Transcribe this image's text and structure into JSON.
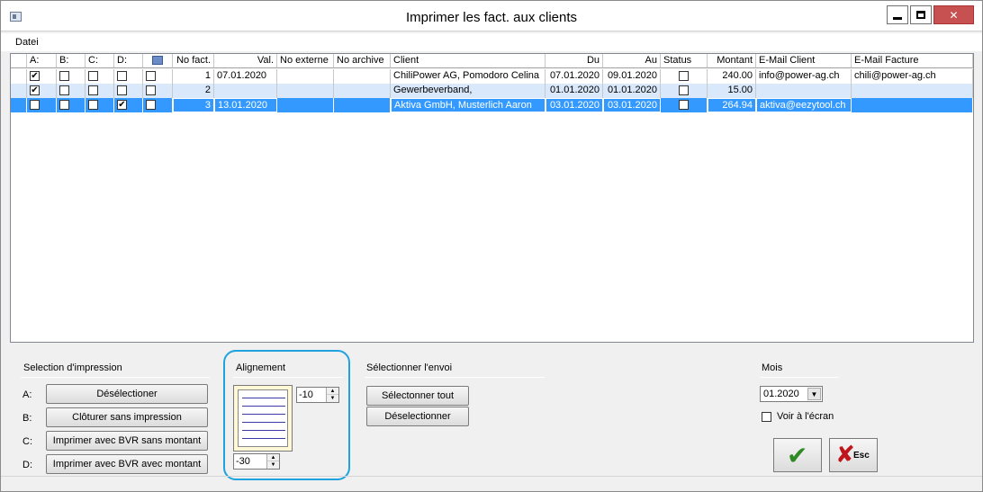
{
  "window": {
    "title": "Imprimer les fact. aux clients"
  },
  "menu": {
    "file": "Datei"
  },
  "table": {
    "headers": {
      "a": "A:",
      "b": "B:",
      "c": "C:",
      "d": "D:",
      "no_fact": "No fact.",
      "val": "Val.",
      "no_externe": "No externe",
      "no_archive": "No archive",
      "client": "Client",
      "du": "Du",
      "au": "Au",
      "status": "Status",
      "montant": "Montant",
      "email_client": "E-Mail Client",
      "email_facture": "E-Mail Facture"
    },
    "rows": [
      {
        "a": "✔",
        "b": "",
        "c": "",
        "d": "",
        "e": "",
        "no_fact": "1",
        "val": "07.01.2020",
        "no_externe": "",
        "no_archive": "",
        "client": "ChiliPower AG, Pomodoro Celina",
        "du": "07.01.2020",
        "au": "09.01.2020",
        "status": "",
        "montant": "240.00",
        "email_client": "info@power-ag.ch",
        "email_facture": "chili@power-ag.ch"
      },
      {
        "a": "✔",
        "b": "",
        "c": "",
        "d": "",
        "e": "",
        "no_fact": "2",
        "val": "",
        "no_externe": "",
        "no_archive": "",
        "client": "Gewerbeverband,",
        "du": "01.01.2020",
        "au": "01.01.2020",
        "status": "",
        "montant": "15.00",
        "email_client": "",
        "email_facture": ""
      },
      {
        "a": "",
        "b": "",
        "c": "",
        "d": "✔",
        "e": "",
        "no_fact": "3",
        "val": "13.01.2020",
        "no_externe": "",
        "no_archive": "",
        "client": "Aktiva GmbH, Musterlich Aaron",
        "du": "03.01.2020",
        "au": "03.01.2020",
        "status": "",
        "montant": "264.94",
        "email_client": "aktiva@eezytool.ch",
        "email_facture": ""
      }
    ]
  },
  "selection": {
    "title": "Selection d'impression",
    "rows": [
      {
        "letter": "A:",
        "button": "Désélectioner"
      },
      {
        "letter": "B:",
        "button": "Clôturer sans impression"
      },
      {
        "letter": "C:",
        "button": "Imprimer avec BVR sans montant"
      },
      {
        "letter": "D:",
        "button": "Imprimer avec BVR avec montant"
      }
    ]
  },
  "alignment": {
    "title": "Alignement",
    "horizontal": "-10",
    "vertical": "-30"
  },
  "send": {
    "title": "Sélectionner l'envoi",
    "select_all": "Sélectonner tout",
    "deselect": "Déselectionner"
  },
  "month": {
    "title": "Mois",
    "value": "01.2020",
    "screen_label": "Voir à l'écran"
  },
  "actions": {
    "esc": "Esc"
  },
  "colors": {
    "selected_row": "#3399ff",
    "alt_row": "#dae8fc",
    "highlight": "#1fa3de"
  }
}
